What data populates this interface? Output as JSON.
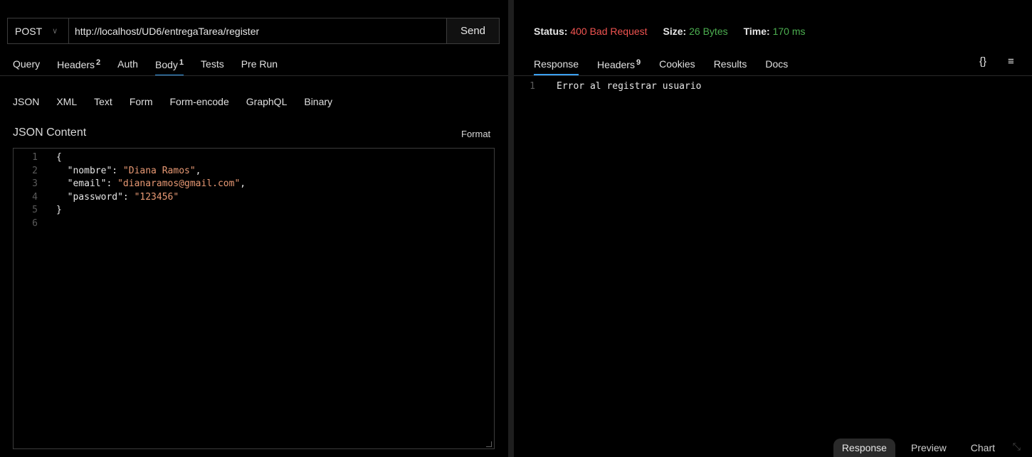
{
  "request": {
    "method": "POST",
    "url": "http://localhost/UD6/entregaTarea/register",
    "send_label": "Send",
    "tabs": [
      {
        "label": "Query",
        "badge": ""
      },
      {
        "label": "Headers",
        "badge": "2"
      },
      {
        "label": "Auth",
        "badge": ""
      },
      {
        "label": "Body",
        "badge": "1"
      },
      {
        "label": "Tests",
        "badge": ""
      },
      {
        "label": "Pre Run",
        "badge": ""
      }
    ],
    "active_tab": "Body",
    "body_types": [
      "JSON",
      "XML",
      "Text",
      "Form",
      "Form-encode",
      "GraphQL",
      "Binary"
    ],
    "section_title": "JSON Content",
    "format_label": "Format",
    "code_lines": [
      {
        "n": "1",
        "parts": [
          {
            "t": "{",
            "c": "k"
          }
        ]
      },
      {
        "n": "2",
        "parts": [
          {
            "t": "  \"nombre\": ",
            "c": "k"
          },
          {
            "t": "\"Diana Ramos\"",
            "c": "s"
          },
          {
            "t": ",",
            "c": "k"
          }
        ]
      },
      {
        "n": "3",
        "parts": [
          {
            "t": "  \"email\": ",
            "c": "k"
          },
          {
            "t": "\"dianaramos@gmail.com\"",
            "c": "s"
          },
          {
            "t": ",",
            "c": "k"
          }
        ]
      },
      {
        "n": "4",
        "parts": [
          {
            "t": "  \"password\": ",
            "c": "k"
          },
          {
            "t": "\"123456\"",
            "c": "s"
          }
        ]
      },
      {
        "n": "5",
        "parts": [
          {
            "t": "}",
            "c": "k"
          }
        ]
      },
      {
        "n": "6",
        "parts": []
      }
    ]
  },
  "response": {
    "status_label": "Status:",
    "status_value": "400 Bad Request",
    "size_label": "Size:",
    "size_value": "26 Bytes",
    "time_label": "Time:",
    "time_value": "170 ms",
    "tabs": [
      {
        "label": "Response",
        "badge": ""
      },
      {
        "label": "Headers",
        "badge": "9"
      },
      {
        "label": "Cookies",
        "badge": ""
      },
      {
        "label": "Results",
        "badge": ""
      },
      {
        "label": "Docs",
        "badge": ""
      }
    ],
    "active_tab": "Response",
    "braces_icon": "{}",
    "menu_icon": "≡",
    "lines": [
      {
        "n": "1",
        "text": "Error al registrar usuario"
      }
    ],
    "bottom_tabs": [
      "Response",
      "Preview",
      "Chart"
    ],
    "bottom_active": "Response"
  },
  "colors": {
    "error": "#ef5350",
    "success": "#4caf50",
    "accent": "#3aa0f0",
    "string": "#e89974"
  }
}
